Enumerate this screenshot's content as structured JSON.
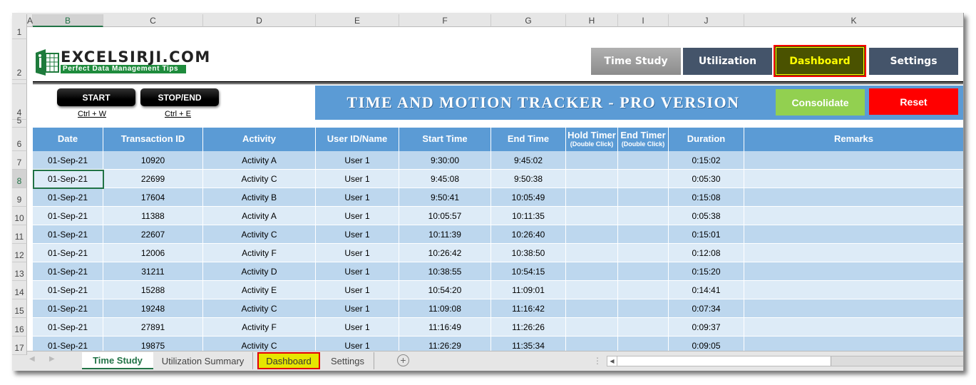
{
  "columns": [
    "A",
    "B",
    "C",
    "D",
    "E",
    "F",
    "G",
    "H",
    "I",
    "J",
    "K"
  ],
  "row_numbers": [
    "1",
    "2",
    "4",
    "5",
    "6",
    "7",
    "8",
    "9",
    "10",
    "11",
    "12",
    "13",
    "14",
    "15",
    "16",
    "17"
  ],
  "logo": {
    "title": "EXCELSIRJI.COM",
    "tagline": "Perfect Data Management Tips"
  },
  "nav": [
    {
      "label": "Time Study"
    },
    {
      "label": "Utilization"
    },
    {
      "label": "Dashboard"
    },
    {
      "label": "Settings"
    }
  ],
  "controls": {
    "start": "START",
    "start_shortcut": "Ctrl + W",
    "stop": "STOP/END",
    "stop_shortcut": "Ctrl + E"
  },
  "banner": {
    "title": "TIME AND MOTION TRACKER - PRO VERSION",
    "consolidate": "Consolidate",
    "reset": "Reset"
  },
  "table": {
    "headers": [
      {
        "label": "Date"
      },
      {
        "label": "Transaction ID"
      },
      {
        "label": "Activity"
      },
      {
        "label": "User ID/Name"
      },
      {
        "label": "Start Time"
      },
      {
        "label": "End Time"
      },
      {
        "label": "Hold Timer",
        "sub": "(Double Click)"
      },
      {
        "label": "End Timer",
        "sub": "(Double Click)"
      },
      {
        "label": "Duration"
      },
      {
        "label": "Remarks"
      }
    ],
    "rows": [
      [
        "01-Sep-21",
        "10920",
        "Activity A",
        "User 1",
        "9:30:00",
        "9:45:02",
        "",
        "",
        "0:15:02",
        ""
      ],
      [
        "01-Sep-21",
        "22699",
        "Activity C",
        "User 1",
        "9:45:08",
        "9:50:38",
        "",
        "",
        "0:05:30",
        ""
      ],
      [
        "01-Sep-21",
        "17604",
        "Activity B",
        "User 1",
        "9:50:41",
        "10:05:49",
        "",
        "",
        "0:15:08",
        ""
      ],
      [
        "01-Sep-21",
        "11388",
        "Activity A",
        "User 1",
        "10:05:57",
        "10:11:35",
        "",
        "",
        "0:05:38",
        ""
      ],
      [
        "01-Sep-21",
        "22607",
        "Activity C",
        "User 1",
        "10:11:39",
        "10:26:40",
        "",
        "",
        "0:15:01",
        ""
      ],
      [
        "01-Sep-21",
        "12006",
        "Activity F",
        "User 1",
        "10:26:42",
        "10:38:50",
        "",
        "",
        "0:12:08",
        ""
      ],
      [
        "01-Sep-21",
        "31211",
        "Activity D",
        "User 1",
        "10:38:55",
        "10:54:15",
        "",
        "",
        "0:15:20",
        ""
      ],
      [
        "01-Sep-21",
        "15288",
        "Activity E",
        "User 1",
        "10:54:20",
        "11:09:01",
        "",
        "",
        "0:14:41",
        ""
      ],
      [
        "01-Sep-21",
        "19248",
        "Activity C",
        "User 1",
        "11:09:08",
        "11:16:42",
        "",
        "",
        "0:07:34",
        ""
      ],
      [
        "01-Sep-21",
        "27891",
        "Activity F",
        "User 1",
        "11:16:49",
        "11:26:26",
        "",
        "",
        "0:09:37",
        ""
      ],
      [
        "01-Sep-21",
        "19875",
        "Activity C",
        "User 1",
        "11:26:29",
        "11:35:34",
        "",
        "",
        "0:09:05",
        ""
      ]
    ]
  },
  "sheet_tabs": [
    {
      "label": "Time Study",
      "active": true
    },
    {
      "label": "Utilization Summary"
    },
    {
      "label": "Dashboard",
      "highlight": true
    },
    {
      "label": "Settings"
    }
  ],
  "colors": {
    "header_blue": "#5b9bd5",
    "row_dark": "#bdd7ee",
    "row_light": "#ddebf7",
    "banner": "#5b9bd5",
    "consolidate": "#92d050",
    "reset": "#ff0000",
    "dashboard_bg": "#4a5200",
    "dashboard_text": "#ffff00",
    "nav_dark": "#44546a",
    "excel_green": "#217346"
  }
}
